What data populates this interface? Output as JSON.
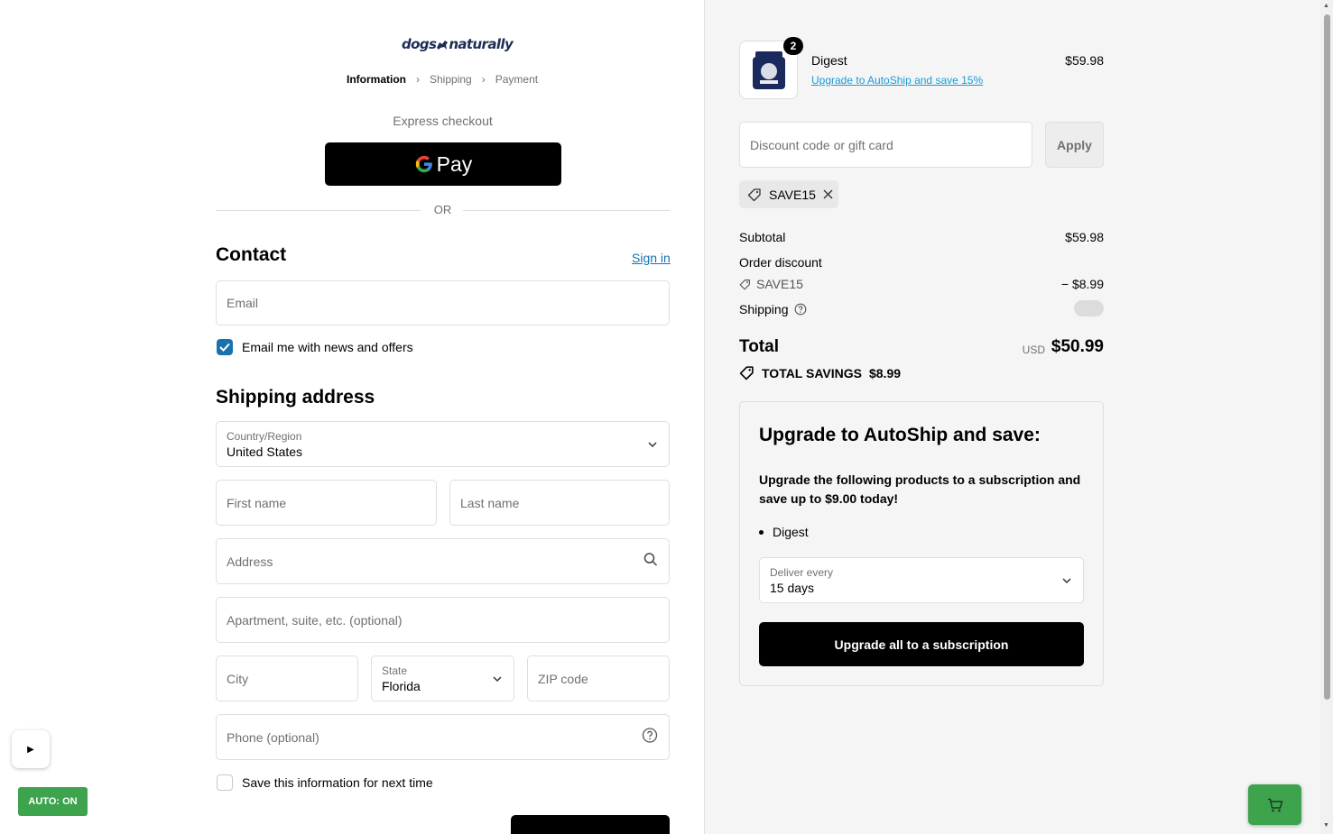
{
  "brand": {
    "logo_text_1": "dogs",
    "logo_text_2": "naturally"
  },
  "breadcrumb": {
    "step1": "Information",
    "step2": "Shipping",
    "step3": "Payment"
  },
  "express": {
    "label": "Express checkout",
    "gpay_label": "Pay"
  },
  "divider": {
    "label": "OR"
  },
  "contact": {
    "title": "Contact",
    "sign_in": "Sign in",
    "email_placeholder": "Email",
    "newsletter_label": "Email me with news and offers",
    "newsletter_checked": true
  },
  "shipping": {
    "title": "Shipping address",
    "country_label": "Country/Region",
    "country_value": "United States",
    "first_name_placeholder": "First name",
    "last_name_placeholder": "Last name",
    "address_placeholder": "Address",
    "apartment_placeholder": "Apartment, suite, etc. (optional)",
    "city_placeholder": "City",
    "state_label": "State",
    "state_value": "Florida",
    "zip_placeholder": "ZIP code",
    "phone_placeholder": "Phone (optional)",
    "save_info_label": "Save this information for next time",
    "save_info_checked": false
  },
  "widgets": {
    "auto_label": "AUTO: ON",
    "play_glyph": "▶"
  },
  "order": {
    "item": {
      "name": "Digest",
      "quantity": "2",
      "upgrade_link": "Upgrade to AutoShip and save 15%",
      "price": "$59.98"
    },
    "discount_placeholder": "Discount code or gift card",
    "apply_label": "Apply",
    "applied_code": "SAVE15",
    "subtotal_label": "Subtotal",
    "subtotal_value": "$59.98",
    "order_discount_label": "Order discount",
    "discount_code": "SAVE15",
    "discount_value": "− $8.99",
    "shipping_label": "Shipping",
    "total_label": "Total",
    "currency": "USD",
    "total_value": "$50.99",
    "savings_label": "TOTAL SAVINGS",
    "savings_value": "$8.99"
  },
  "upgrade": {
    "title": "Upgrade to AutoShip and save:",
    "description": "Upgrade the following products to a subscription and save up to $9.00 today!",
    "item": "Digest",
    "deliver_label": "Deliver every",
    "deliver_value": "15 days",
    "button_label": "Upgrade all to a subscription"
  },
  "colors": {
    "accent_link": "#1773b0",
    "upgrade_link": "#1a9bd7",
    "green": "#3da34d"
  }
}
